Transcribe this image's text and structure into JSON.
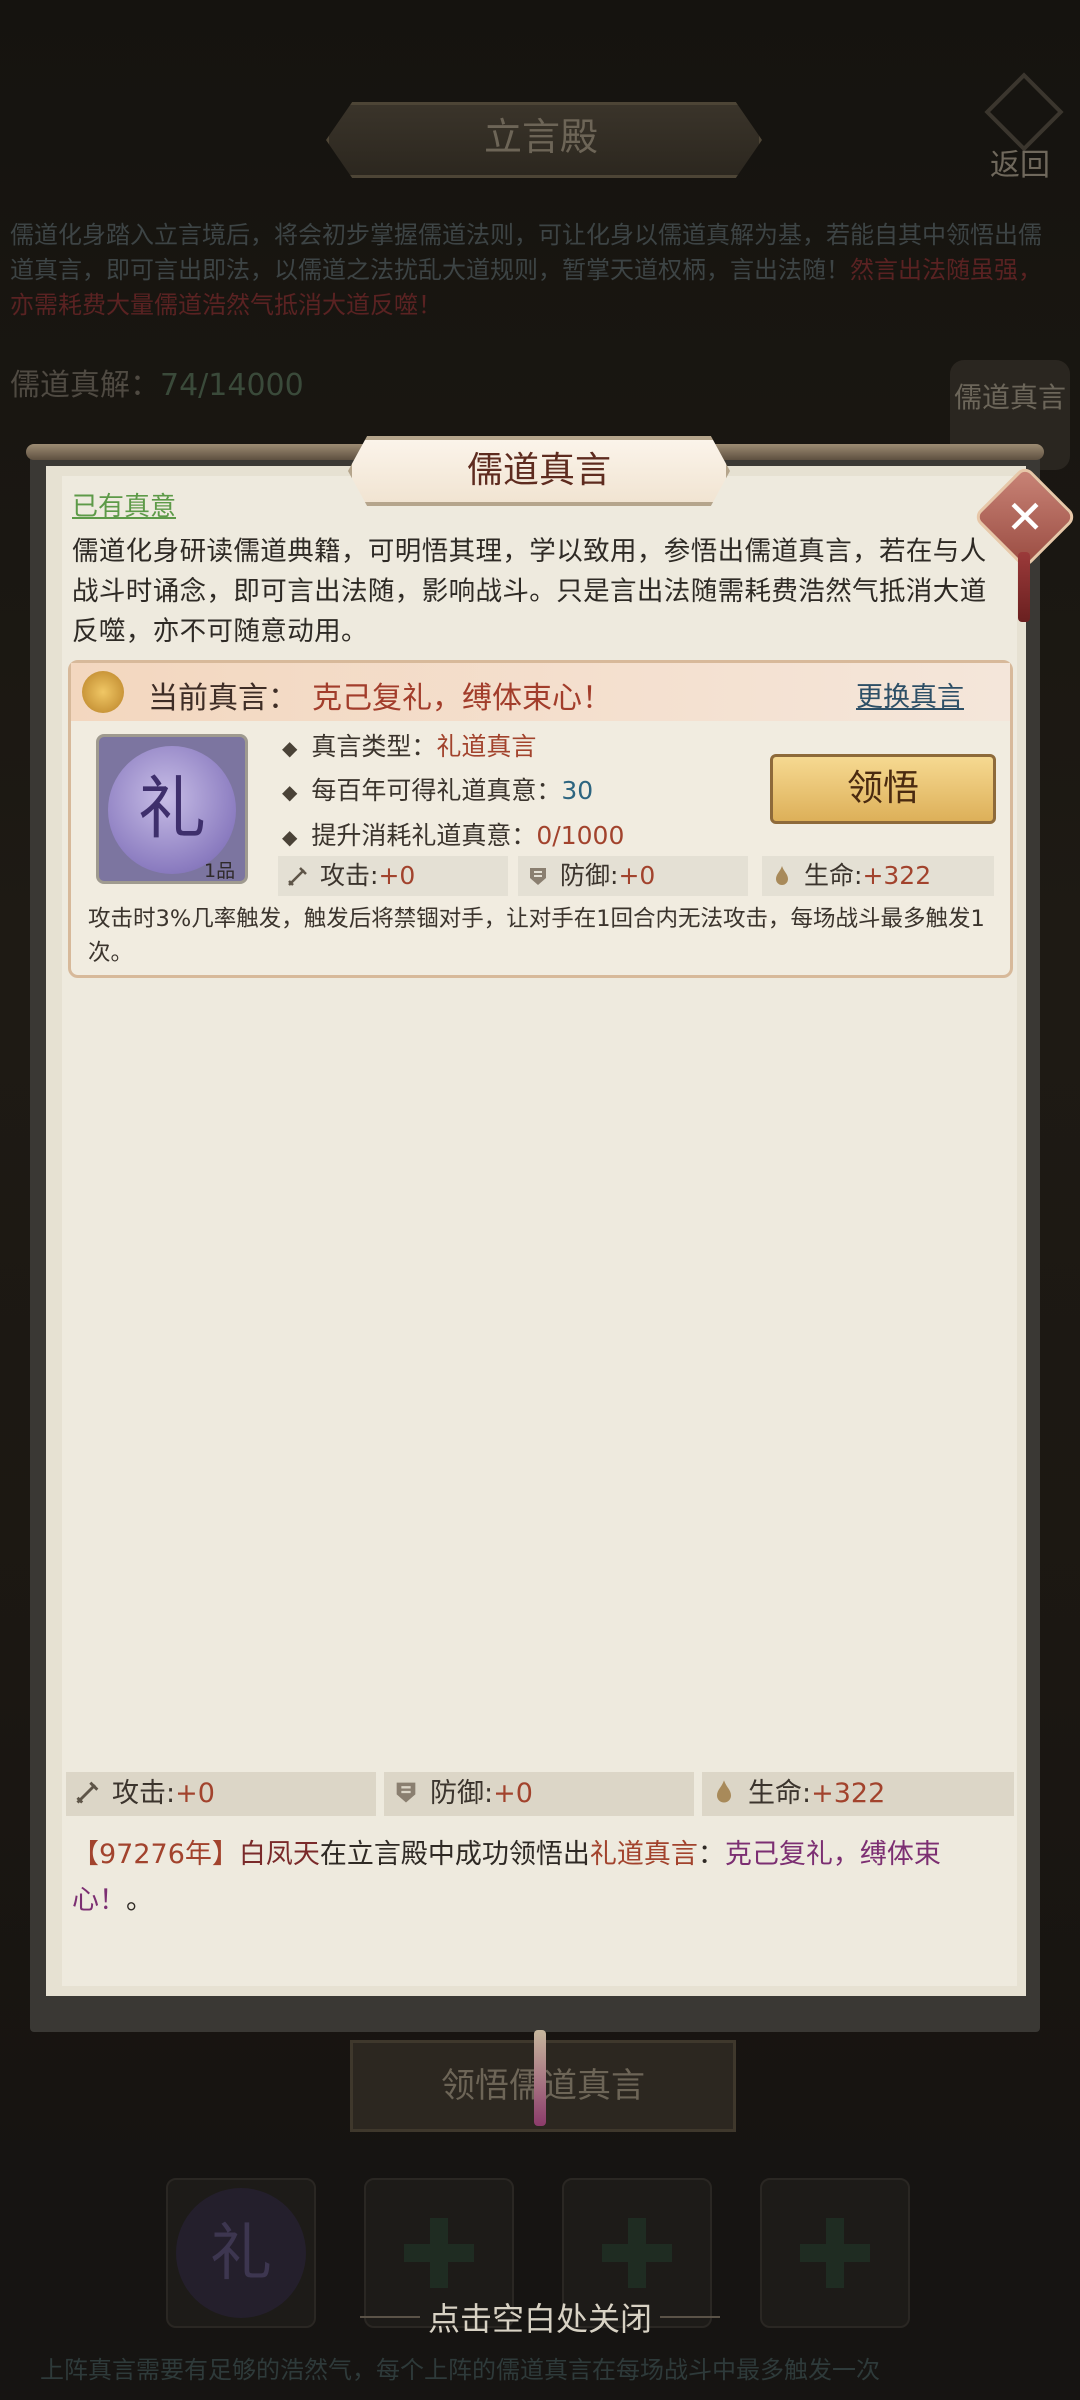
{
  "background_page": {
    "title": "立言殿",
    "back_label": "返回",
    "intro": "儒道化身踏入立言境后，将会初步掌握儒道法则，可让化身以儒道真解为基，若能自其中领悟出儒道真言，即可言出即法，以儒道之法扰乱大道规则，暂掌天道权柄，言出法随！",
    "intro_warning": "然言出法随虽强，亦需耗费大量儒道浩然气抵消大道反噬！",
    "progress_label": "儒道真解：",
    "progress_value": "74/14000",
    "side_button": "儒道真言",
    "bottom_button": "领悟儒道真言",
    "slot_coin_char": "礼",
    "footer_text": "上阵真言需要有足够的浩然气，每个上阵的儒道真言在每场战斗中最多触发一次"
  },
  "dialog": {
    "title": "儒道真言",
    "has_intent_link": "已有真意",
    "description": "儒道化身研读儒道典籍，可明悟其理，学以致用，参悟出儒道真言，若在与人战斗时诵念，即可言出法随，影响战斗。只是言出法随需耗费浩然气抵消大道反噬，亦不可随意动用。",
    "current": {
      "label": "当前真言：",
      "value": "克己复礼，缚体束心！",
      "change_link": "更换真言",
      "icon_char": "礼",
      "icon_grade": "1品",
      "type_label": "真言类型：",
      "type_value": "礼道真言",
      "gain_label": "每百年可得礼道真意：",
      "gain_value": "30",
      "cost_label": "提升消耗礼道真意：",
      "cost_value": "0/1000",
      "button": "领悟",
      "attack_label": "攻击:",
      "attack_value": "+0",
      "defense_label": "防御:",
      "defense_value": "+0",
      "life_label": "生命:",
      "life_value": "+322",
      "effect": "攻击时3%几率触发，触发后将禁锢对手，让对手在1回合内无法攻击，每场战斗最多触发1次。"
    },
    "summary": {
      "attack_label": "攻击:",
      "attack_value": "+0",
      "defense_label": "防御:",
      "defense_value": "+0",
      "life_label": "生命:",
      "life_value": "+322"
    },
    "log": {
      "year": "【97276年】",
      "name": "白凤天",
      "text1": "在立言殿中成功领悟出",
      "type": "礼道真言",
      "colon": "：",
      "word": "克己复礼，缚体束心！",
      "end": "。"
    }
  },
  "close_hint": "点击空白处关闭",
  "colors": {
    "accent_red": "#a2432d",
    "link_blue": "#2d4f66",
    "link_green": "#5d9a48",
    "gold_button": "#ddb059"
  }
}
